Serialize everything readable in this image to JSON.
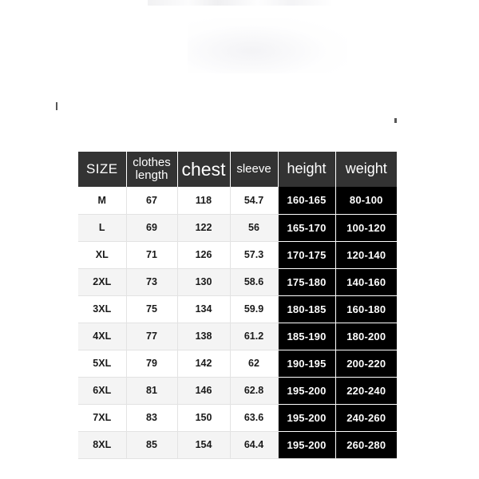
{
  "page": {
    "background_color": "#ffffff",
    "header_color": "#333333",
    "dark_cell_color": "#000000",
    "stripe_color": "#f4f4f4"
  },
  "size_chart": {
    "columns": [
      {
        "key": "size",
        "label": "SIZE"
      },
      {
        "key": "length",
        "label": "clothes length"
      },
      {
        "key": "chest",
        "label": "chest"
      },
      {
        "key": "sleeve",
        "label": "sleeve"
      },
      {
        "key": "height",
        "label": "height"
      },
      {
        "key": "weight",
        "label": "weight"
      }
    ],
    "header_labels": {
      "size": "SIZE",
      "length_line1": "clothes",
      "length_line2": "length",
      "chest": "chest",
      "sleeve": "sleeve",
      "height": "height",
      "weight": "weight"
    },
    "rows": [
      {
        "size": "M",
        "length": "67",
        "chest": "118",
        "sleeve": "54.7",
        "height": "160-165",
        "weight": "80-100"
      },
      {
        "size": "L",
        "length": "69",
        "chest": "122",
        "sleeve": "56",
        "height": "165-170",
        "weight": "100-120"
      },
      {
        "size": "XL",
        "length": "71",
        "chest": "126",
        "sleeve": "57.3",
        "height": "170-175",
        "weight": "120-140"
      },
      {
        "size": "2XL",
        "length": "73",
        "chest": "130",
        "sleeve": "58.6",
        "height": "175-180",
        "weight": "140-160"
      },
      {
        "size": "3XL",
        "length": "75",
        "chest": "134",
        "sleeve": "59.9",
        "height": "180-185",
        "weight": "160-180"
      },
      {
        "size": "4XL",
        "length": "77",
        "chest": "138",
        "sleeve": "61.2",
        "height": "185-190",
        "weight": "180-200"
      },
      {
        "size": "5XL",
        "length": "79",
        "chest": "142",
        "sleeve": "62",
        "height": "190-195",
        "weight": "200-220"
      },
      {
        "size": "6XL",
        "length": "81",
        "chest": "146",
        "sleeve": "62.8",
        "height": "195-200",
        "weight": "220-240"
      },
      {
        "size": "7XL",
        "length": "83",
        "chest": "150",
        "sleeve": "63.6",
        "height": "195-200",
        "weight": "240-260"
      },
      {
        "size": "8XL",
        "length": "85",
        "chest": "154",
        "sleeve": "64.4",
        "height": "195-200",
        "weight": "260-280"
      }
    ]
  }
}
